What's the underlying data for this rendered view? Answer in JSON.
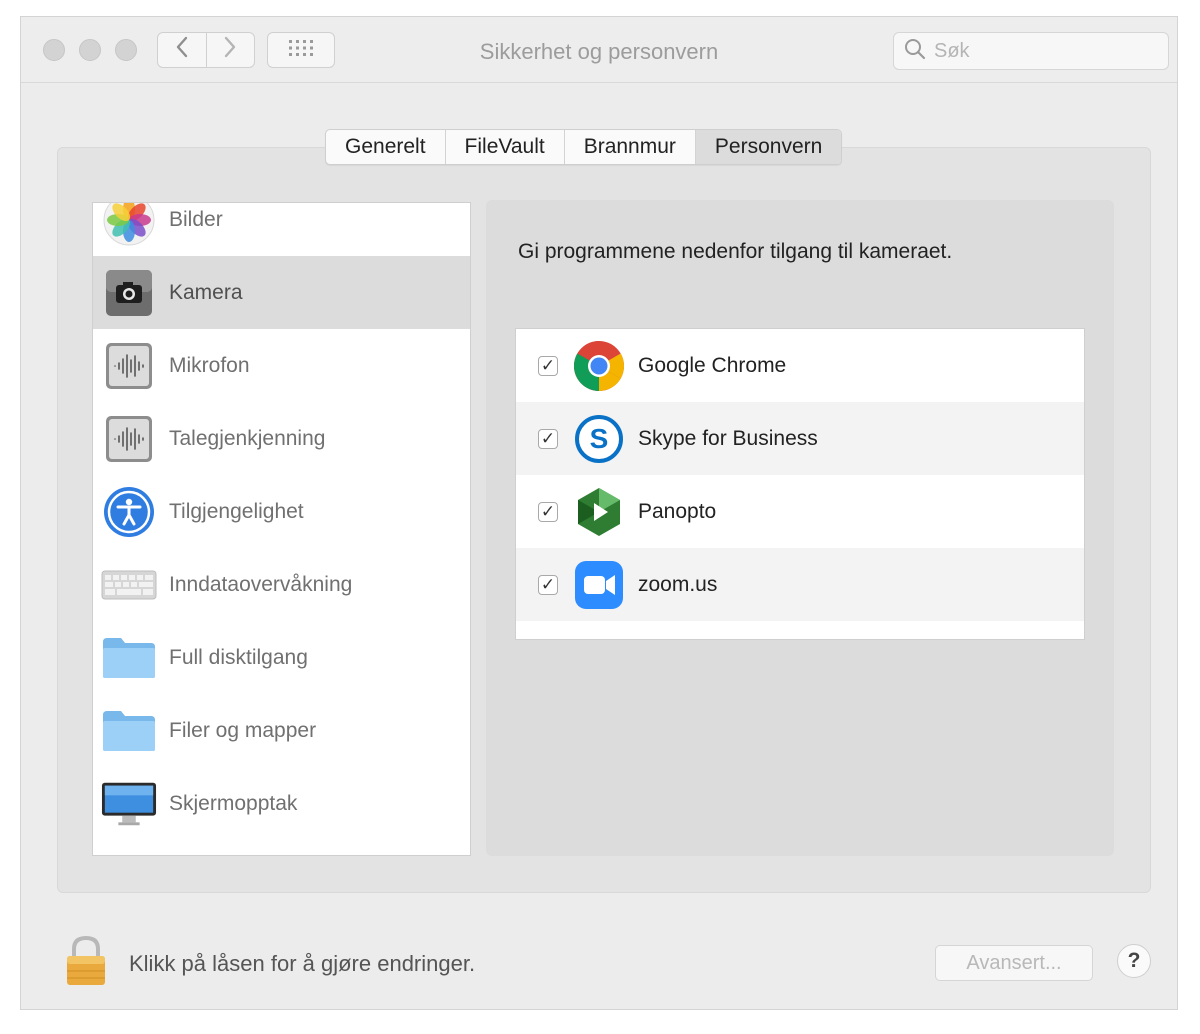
{
  "window": {
    "title": "Sikkerhet og personvern"
  },
  "toolbar": {
    "back_icon": "chevron-left-icon",
    "forward_icon": "chevron-right-icon",
    "grid_icon": "grid-icon"
  },
  "search": {
    "placeholder": "Søk"
  },
  "tabs": [
    {
      "label": "Generelt",
      "active": false
    },
    {
      "label": "FileVault",
      "active": false
    },
    {
      "label": "Brannmur",
      "active": false
    },
    {
      "label": "Personvern",
      "active": true
    }
  ],
  "sidebar": {
    "items": [
      {
        "label": "Bilder",
        "icon": "photos-icon"
      },
      {
        "label": "Kamera",
        "icon": "camera-icon",
        "selected": true
      },
      {
        "label": "Mikrofon",
        "icon": "microphone-icon"
      },
      {
        "label": "Talegjenkjenning",
        "icon": "speech-recognition-icon"
      },
      {
        "label": "Tilgjengelighet",
        "icon": "accessibility-icon"
      },
      {
        "label": "Inndataovervåkning",
        "icon": "keyboard-icon"
      },
      {
        "label": "Full disktilgang",
        "icon": "folder-icon"
      },
      {
        "label": "Filer og mapper",
        "icon": "folder-icon"
      },
      {
        "label": "Skjermopptak",
        "icon": "display-icon"
      }
    ]
  },
  "main": {
    "description": "Gi programmene nedenfor tilgang til kameraet.",
    "apps": [
      {
        "name": "Google Chrome",
        "checked": true,
        "icon": "chrome-icon"
      },
      {
        "name": "Skype for Business",
        "checked": true,
        "icon": "skype-icon"
      },
      {
        "name": "Panopto",
        "checked": true,
        "icon": "panopto-icon"
      },
      {
        "name": "zoom.us",
        "checked": true,
        "icon": "zoom-icon"
      }
    ]
  },
  "footer": {
    "lock_text": "Klikk på låsen for å gjøre endringer.",
    "advanced_label": "Avansert...",
    "help_label": "?"
  }
}
